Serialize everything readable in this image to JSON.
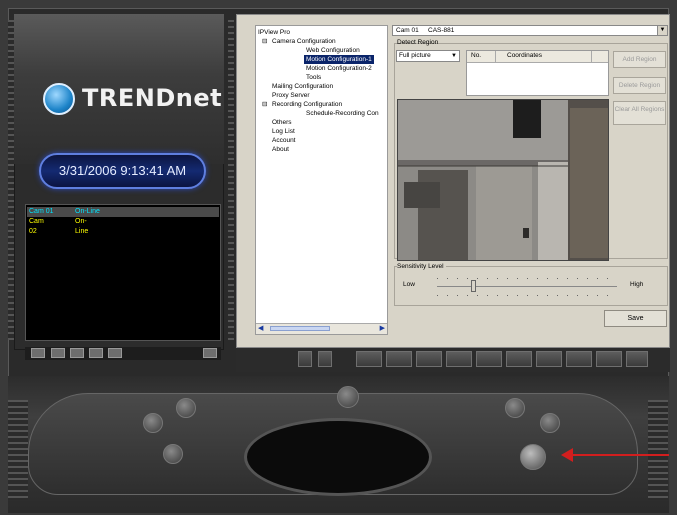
{
  "brand": {
    "name": "TRENDnet"
  },
  "clock": {
    "datetime": "3/31/2006 9:13:41 AM"
  },
  "camera_list": [
    {
      "name": "Cam 01",
      "status": "On-Line"
    },
    {
      "name": "Cam 02",
      "status": "On-Line"
    }
  ],
  "tree": {
    "root": "IPView Pro",
    "camera_configuration": "Camera Configuration",
    "web_configuration": "Web Configuration",
    "motion_configuration_1": "Motion Configuration-1",
    "motion_configuration_2": "Motion Configuration-2",
    "tools": "Tools",
    "mailing_configuration": "Mailing Configuration",
    "proxy_server": "Proxy Server",
    "recording_configuration": "Recording Configuration",
    "schedule_recording": "Schedule-Recording Con",
    "others": "Others",
    "log_list": "Log List",
    "account": "Account",
    "about": "About"
  },
  "camera_selector": {
    "label": "Cam 01",
    "model": "CAS-881"
  },
  "detect_region": {
    "label": "Detect Region",
    "mode": "Full picture",
    "table_headers": [
      "No.",
      "Coordinates"
    ],
    "add_region": "Add Region",
    "delete_region": "Delete Region",
    "clear_all_regions": "Clear All Regions"
  },
  "sensitivity": {
    "label": "Sensitivity Level",
    "low": "Low",
    "high": "High",
    "level_fraction": 0.2
  },
  "save_button": "Save",
  "colors": {
    "selected_blue": "#0a246a",
    "cam_selected": "#00e5ff",
    "cam_online": "#ffff00",
    "arrow_red": "#d21e1e"
  },
  "icons": [
    "tree-expand-icon",
    "dropdown-arrow-icon",
    "scroll-left-icon",
    "scroll-right-icon",
    "layout-grid-icon",
    "record-button-icon"
  ]
}
